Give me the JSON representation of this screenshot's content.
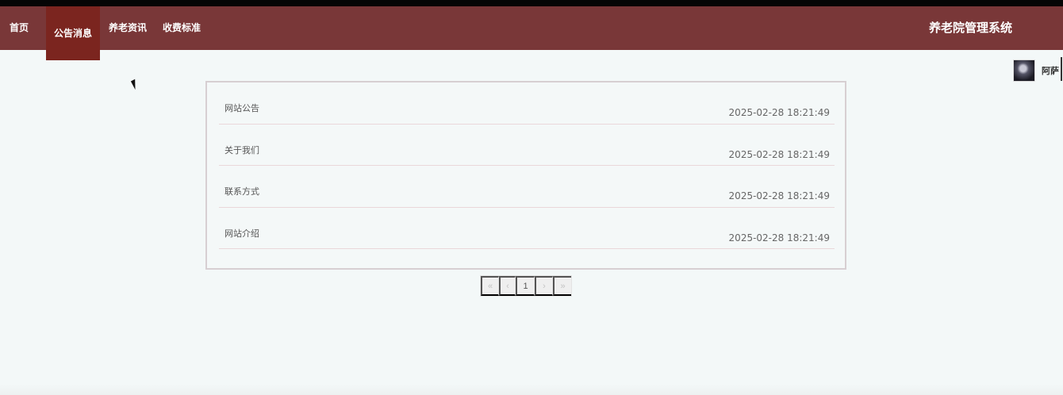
{
  "nav": {
    "items": [
      "首页",
      "公告消息",
      "养老资讯",
      "收费标准"
    ],
    "brand": "养老院管理系统"
  },
  "user": {
    "name": "阿萨"
  },
  "notices": [
    {
      "title": "网站公告",
      "date": "2025-02-28 18:21:49"
    },
    {
      "title": "关于我们",
      "date": "2025-02-28 18:21:49"
    },
    {
      "title": "联系方式",
      "date": "2025-02-28 18:21:49"
    },
    {
      "title": "网站介绍",
      "date": "2025-02-28 18:21:49"
    }
  ],
  "pagination": {
    "first": "«",
    "prev": "‹",
    "current": "1",
    "next": "›",
    "last": "»"
  },
  "colors": {
    "nav": "#793738",
    "active": "#7b251f",
    "page": "#f3f8f8"
  }
}
